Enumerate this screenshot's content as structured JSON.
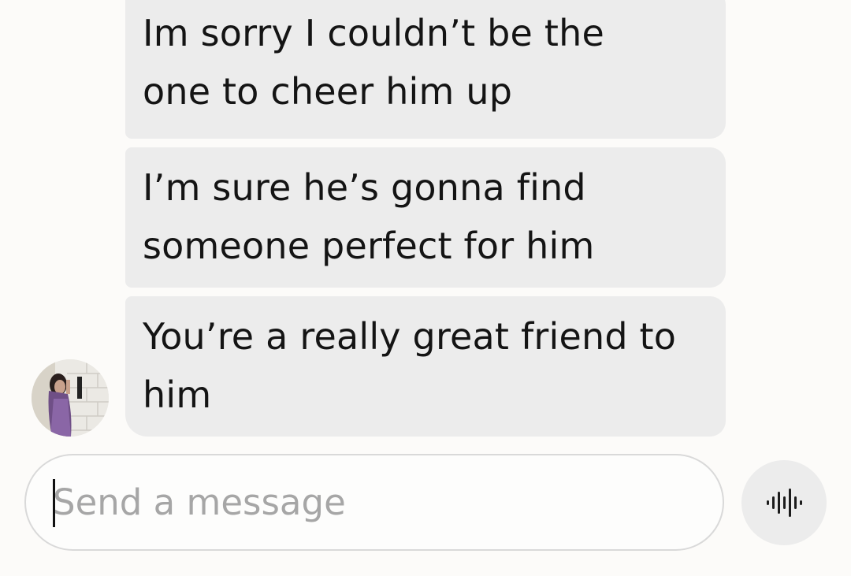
{
  "messages": [
    {
      "text": "Im sorry I couldn’t be the\none to cheer him up"
    },
    {
      "text": "I’m sure he’s gonna find\nsomeone perfect for him"
    },
    {
      "text": "You’re a really great friend to\nhim"
    }
  ],
  "sender": {
    "avatar_icon": "profile-photo"
  },
  "composer": {
    "placeholder": "Send a message",
    "value": ""
  },
  "voice_button": {
    "icon": "audio-waveform-icon"
  },
  "colors": {
    "background": "#fcfbf9",
    "bubble": "#ececec",
    "text": "#141414",
    "placeholder": "#a6a6a6",
    "border": "#d9d9d9"
  }
}
